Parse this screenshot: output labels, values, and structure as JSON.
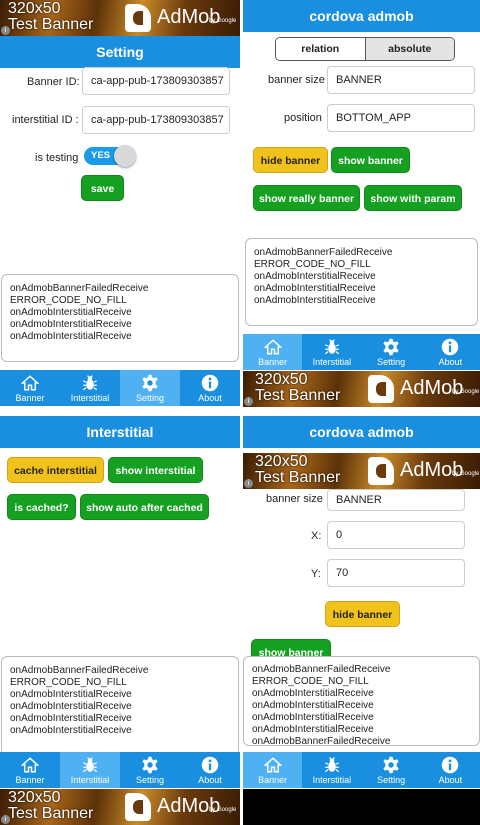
{
  "ad": {
    "line1": "320x50",
    "line2": "Test Banner",
    "brand": "AdMob",
    "by": "by Google",
    "info": "i"
  },
  "nav": {
    "banner": "Banner",
    "interstitial": "Interstitial",
    "setting": "Setting",
    "about": "About"
  },
  "setting": {
    "title": "Setting",
    "banner_id_label": "Banner ID:",
    "banner_id_value": "ca-app-pub-173809303857",
    "interstitial_id_label": "interstitial ID :",
    "interstitial_id_value": "ca-app-pub-173809303857",
    "testing_label": "is testing",
    "toggle": "YES",
    "save": "save",
    "log": [
      "onAdmobBannerFailedReceive",
      "ERROR_CODE_NO_FILL",
      "onAdmobInterstitialReceive",
      "onAdmobInterstitialReceive",
      "onAdmobInterstitialReceive"
    ]
  },
  "banner": {
    "title": "cordova admob",
    "seg": [
      "relation",
      "absolute"
    ],
    "size_label": "banner size",
    "size_value": "BANNER",
    "position_label": "position",
    "position_value": "BOTTOM_APP",
    "hide": "hide banner",
    "show": "show banner",
    "show_really": "show really banner",
    "show_param": "show with param",
    "log": [
      "onAdmobBannerFailedReceive",
      "ERROR_CODE_NO_FILL",
      "onAdmobInterstitialReceive",
      "onAdmobInterstitialReceive",
      "onAdmobInterstitialReceive"
    ]
  },
  "interstitial": {
    "title": "Interstitial",
    "cache": "cache interstitial",
    "show": "show interstitial",
    "is_cached": "is cached?",
    "show_auto": "show auto after cached",
    "log": [
      "onAdmobBannerFailedReceive",
      "ERROR_CODE_NO_FILL",
      "onAdmobInterstitialReceive",
      "onAdmobInterstitialReceive",
      "onAdmobInterstitialReceive",
      "onAdmobInterstitialReceive"
    ]
  },
  "absolute": {
    "title": "cordova admob",
    "size_label": "banner size",
    "size_value": "BANNER",
    "x_label": "X:",
    "x_value": "0",
    "y_label": "Y:",
    "y_value": "70",
    "hide": "hide banner",
    "show": "show banner",
    "log": [
      "onAdmobBannerFailedReceive",
      "ERROR_CODE_NO_FILL",
      "onAdmobInterstitialReceive",
      "onAdmobInterstitialReceive",
      "onAdmobInterstitialReceive",
      "onAdmobInterstitialReceive",
      "onAdmobBannerFailedReceive"
    ]
  }
}
